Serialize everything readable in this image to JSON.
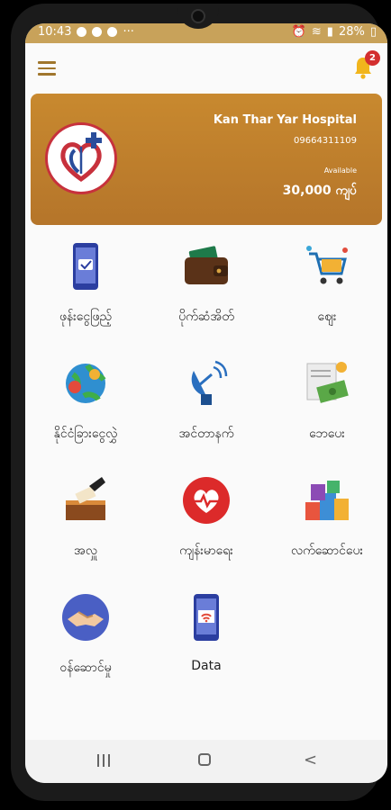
{
  "status_bar": {
    "time": "10:43",
    "battery": "28%"
  },
  "header": {
    "notification_count": "2"
  },
  "hospital_card": {
    "name": "Kan Thar Yar Hospital",
    "phone": "09664311109",
    "available_label": "Available",
    "balance": "30,000 ကျပ်"
  },
  "services": [
    {
      "label": "ဖုန်းငွေဖြည့်",
      "icon": "phone-topup-icon"
    },
    {
      "label": "ပိုက်ဆံအိတ်",
      "icon": "wallet-icon"
    },
    {
      "label": "ဈေး",
      "icon": "shopping-cart-icon"
    },
    {
      "label": "နိုင်ငံခြားငွေလွှဲ",
      "icon": "globe-money-icon"
    },
    {
      "label": "အင်တာနက်",
      "icon": "satellite-dish-icon"
    },
    {
      "label": "ဘေပေး",
      "icon": "bill-pay-icon"
    },
    {
      "label": "အလှူ",
      "icon": "donation-box-icon"
    },
    {
      "label": "ကျန်းမာရေး",
      "icon": "heart-health-icon"
    },
    {
      "label": "လက်ဆောင်ပေး",
      "icon": "gift-boxes-icon"
    },
    {
      "label": "ဝန်ဆောင်မှု",
      "icon": "handshake-icon"
    },
    {
      "label": "Data",
      "icon": "mobile-data-icon"
    }
  ],
  "colors": {
    "accent": "#c8892f",
    "status_bar": "#c8a25a",
    "badge": "#d32f2f"
  }
}
